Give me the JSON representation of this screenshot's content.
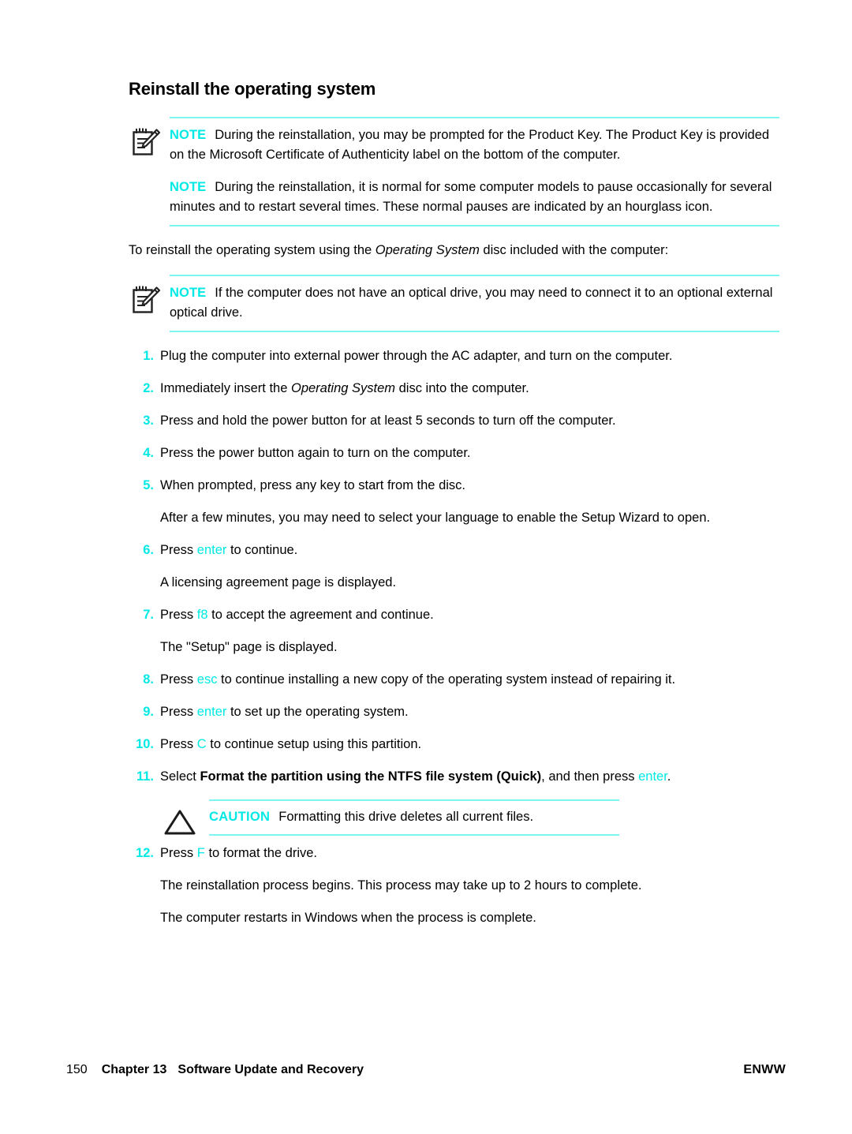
{
  "page": {
    "heading": "Reinstall the operating system"
  },
  "note_block_1": {
    "icon": "note-pad-pencil-icon",
    "notes": [
      {
        "tag": "NOTE",
        "text": "During the reinstallation, you may be prompted for the Product Key. The Product Key is provided on the Microsoft Certificate of Authenticity label on the bottom of the computer."
      },
      {
        "tag": "NOTE",
        "text": "During the reinstallation, it is normal for some computer models to pause occasionally for several minutes and to restart several times. These normal pauses are indicated by an hourglass icon."
      }
    ]
  },
  "intro": {
    "before": "To reinstall the operating system using the ",
    "italic": "Operating System",
    "after": " disc included with the computer:"
  },
  "note_block_2": {
    "icon": "note-pad-pencil-icon",
    "tag": "NOTE",
    "text": "If the computer does not have an optical drive, you may need to connect it to an optional external optical drive."
  },
  "steps": [
    {
      "num": "1.",
      "parts": [
        {
          "t": "plain",
          "v": "Plug the computer into external power through the AC adapter, and turn on the computer."
        }
      ]
    },
    {
      "num": "2.",
      "parts": [
        {
          "t": "plain",
          "v": "Immediately insert the "
        },
        {
          "t": "italic",
          "v": "Operating System"
        },
        {
          "t": "plain",
          "v": " disc into the computer."
        }
      ]
    },
    {
      "num": "3.",
      "parts": [
        {
          "t": "plain",
          "v": "Press and hold the power button for at least 5 seconds to turn off the computer."
        }
      ]
    },
    {
      "num": "4.",
      "parts": [
        {
          "t": "plain",
          "v": "Press the power button again to turn on the computer."
        }
      ]
    },
    {
      "num": "5.",
      "parts": [
        {
          "t": "plain",
          "v": "When prompted, press any key to start from the disc."
        }
      ],
      "follow": "After a few minutes, you may need to select your language to enable the Setup Wizard to open."
    },
    {
      "num": "6.",
      "parts": [
        {
          "t": "plain",
          "v": "Press "
        },
        {
          "t": "key",
          "v": "enter"
        },
        {
          "t": "plain",
          "v": " to continue."
        }
      ],
      "follow": "A licensing agreement page is displayed."
    },
    {
      "num": "7.",
      "parts": [
        {
          "t": "plain",
          "v": "Press "
        },
        {
          "t": "key",
          "v": "f8"
        },
        {
          "t": "plain",
          "v": " to accept the agreement and continue."
        }
      ],
      "follow": "The \"Setup\" page is displayed."
    },
    {
      "num": "8.",
      "parts": [
        {
          "t": "plain",
          "v": "Press "
        },
        {
          "t": "key",
          "v": "esc"
        },
        {
          "t": "plain",
          "v": " to continue installing a new copy of the operating system instead of repairing it."
        }
      ]
    },
    {
      "num": "9.",
      "parts": [
        {
          "t": "plain",
          "v": "Press "
        },
        {
          "t": "key",
          "v": "enter"
        },
        {
          "t": "plain",
          "v": " to set up the operating system."
        }
      ]
    },
    {
      "num": "10.",
      "parts": [
        {
          "t": "plain",
          "v": "Press "
        },
        {
          "t": "key",
          "v": "C"
        },
        {
          "t": "plain",
          "v": " to continue setup using this partition."
        }
      ]
    },
    {
      "num": "11.",
      "parts": [
        {
          "t": "plain",
          "v": "Select "
        },
        {
          "t": "bold",
          "v": "Format the partition using the NTFS file system (Quick)"
        },
        {
          "t": "plain",
          "v": ", and then press "
        },
        {
          "t": "key",
          "v": "enter"
        },
        {
          "t": "plain",
          "v": "."
        }
      ]
    },
    {
      "num": "12.",
      "parts": [
        {
          "t": "plain",
          "v": "Press "
        },
        {
          "t": "key",
          "v": "F"
        },
        {
          "t": "plain",
          "v": " to format the drive."
        }
      ]
    }
  ],
  "caution": {
    "icon": "warning-triangle-icon",
    "tag": "CAUTION",
    "text": "Formatting this drive deletes all current files."
  },
  "closing_paragraphs": [
    "The reinstallation process begins. This process may take up to 2 hours to complete.",
    "The computer restarts in Windows when the process is complete."
  ],
  "footer": {
    "page_number": "150",
    "chapter": "Chapter 13",
    "section": "Software Update and Recovery",
    "locale": "ENWW"
  },
  "colors": {
    "accent_cyan": "#00e9e4",
    "rule_cyan": "#7ef6f0",
    "text": "#000000",
    "background": "#ffffff"
  }
}
